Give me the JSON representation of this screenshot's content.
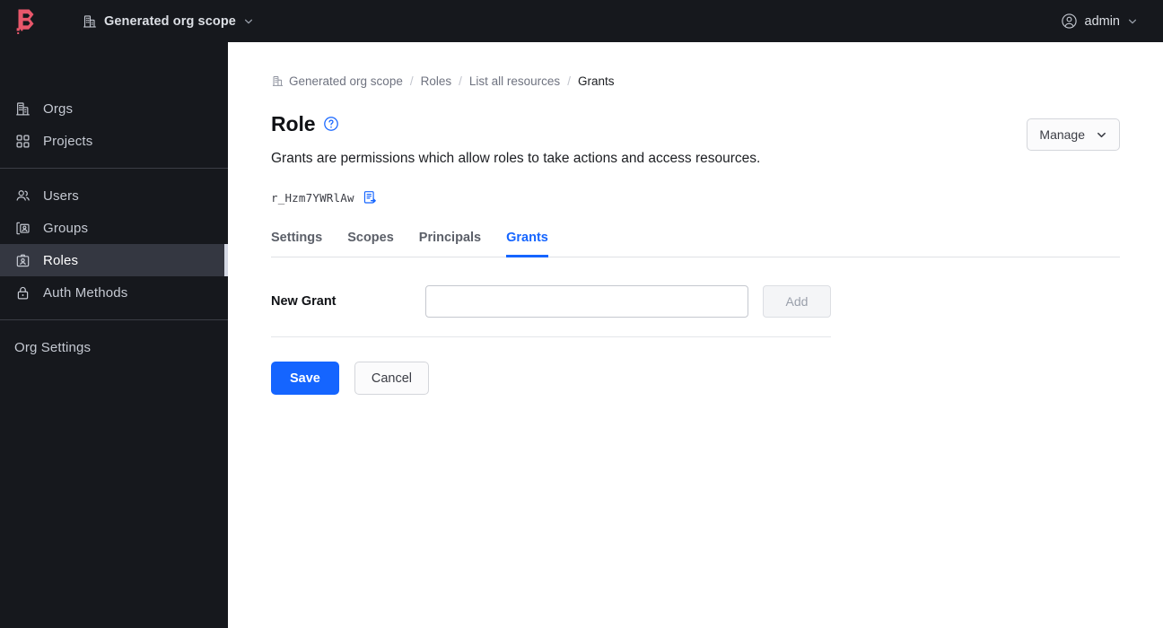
{
  "topbar": {
    "logo_icon": "boundary-logo-icon",
    "logo_color": "#e8576b",
    "org_scope": {
      "icon": "org-building-icon",
      "label": "Generated org scope",
      "chevron": "chevron-down-icon"
    },
    "user": {
      "icon": "user-circle-icon",
      "label": "admin",
      "chevron": "chevron-down-icon"
    },
    "background": "#16181d"
  },
  "sidebar": {
    "background": "#16181d",
    "active_background": "#343741",
    "groups": [
      {
        "items": [
          {
            "icon": "org-building-icon",
            "label": "Orgs",
            "active": false
          },
          {
            "icon": "grid-projects-icon",
            "label": "Projects",
            "active": false
          }
        ]
      },
      {
        "items": [
          {
            "icon": "users-icon",
            "label": "Users",
            "active": false
          },
          {
            "icon": "folder-person-icon",
            "label": "Groups",
            "active": false
          },
          {
            "icon": "id-badge-icon",
            "label": "Roles",
            "active": true
          },
          {
            "icon": "lock-icon",
            "label": "Auth Methods",
            "active": false
          }
        ]
      },
      {
        "items": [
          {
            "icon": "",
            "label": "Org Settings",
            "active": false
          }
        ]
      }
    ]
  },
  "main": {
    "breadcrumb": {
      "icon": "org-building-icon",
      "items": [
        {
          "label": "Generated org scope",
          "current": false
        },
        {
          "label": "Roles",
          "current": false
        },
        {
          "label": "List all resources",
          "current": false
        },
        {
          "label": "Grants",
          "current": true
        }
      ],
      "separator": "/"
    },
    "page_title": "Role",
    "help_icon": "help-circle-icon",
    "page_description": "Grants are permissions which allow roles to take actions and access resources.",
    "manage_button": {
      "label": "Manage",
      "chevron": "chevron-down-icon"
    },
    "resource_id": {
      "value": "r_Hzm7YWRlAw",
      "copy_icon": "copy-clipboard-icon",
      "copy_color": "#1565ff"
    },
    "tabs": [
      {
        "label": "Settings",
        "active": false
      },
      {
        "label": "Scopes",
        "active": false
      },
      {
        "label": "Principals",
        "active": false
      },
      {
        "label": "Grants",
        "active": true
      }
    ],
    "accent_color": "#1565ff",
    "form": {
      "new_grant_label": "New Grant",
      "new_grant_value": "",
      "new_grant_placeholder": "",
      "add_button_label": "Add",
      "add_button_disabled": true
    },
    "actions": {
      "save_label": "Save",
      "cancel_label": "Cancel"
    }
  }
}
